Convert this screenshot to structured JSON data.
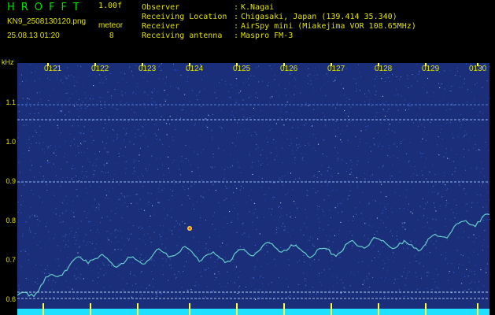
{
  "header": {
    "logo": "HROFFT",
    "version": "1.00f",
    "filename": "KN9_2508130120.png",
    "timestamp": "25.08.13 01:20",
    "meteor_label": "meteor",
    "meteor_count": "8",
    "info": [
      {
        "label": "Observer",
        "value": "K.Nagai"
      },
      {
        "label": "Receiving Location",
        "value": "Chigasaki, Japan (139.414 35.340)"
      },
      {
        "label": "Receiver",
        "value": "AirSpy mini (Miakejima VOR 108.65MHz)"
      },
      {
        "label": "Receiving antenna",
        "value": "Maspro FM-3"
      }
    ]
  },
  "axis": {
    "unit": "kHz",
    "y_ticks": [
      "1.1",
      "1.0",
      "0.9",
      "0.8",
      "0.7",
      "0.6"
    ],
    "x_ticks": [
      "0121",
      "0122",
      "0123",
      "0124",
      "0125",
      "0126",
      "0127",
      "0128",
      "0129",
      "0130"
    ]
  },
  "colors": {
    "text": "#e0e000",
    "logo": "#00e000",
    "background": "#1a2e7a",
    "trace": "#6fe0d0"
  }
}
